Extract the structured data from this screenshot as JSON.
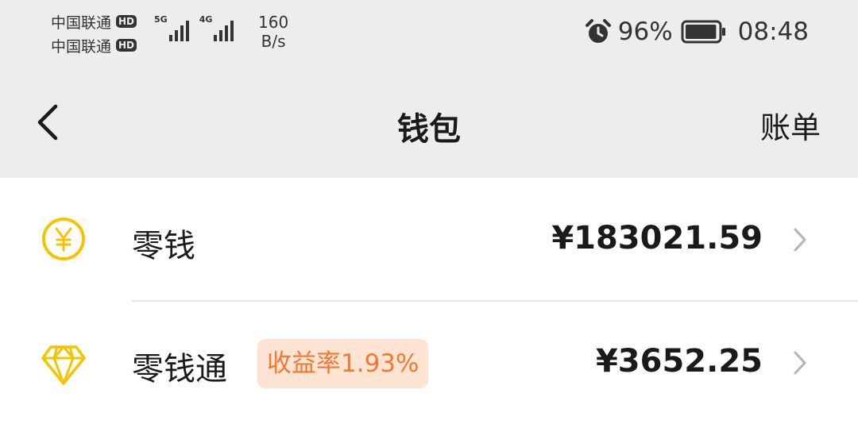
{
  "status_bar": {
    "carriers": [
      {
        "name": "中国联通",
        "badge": "HD"
      },
      {
        "name": "中国联通",
        "badge": "HD"
      }
    ],
    "signals": [
      {
        "network": "5G",
        "strength": 4
      },
      {
        "network": "4G",
        "strength": 4
      }
    ],
    "net_speed_value": "160",
    "net_speed_unit": "B/s",
    "alarm_icon": "alarm-clock-icon",
    "battery_percent": "96%",
    "battery_level": 0.96,
    "time": "08:48"
  },
  "nav": {
    "back_icon": "chevron-left-icon",
    "title": "钱包",
    "action": "账单"
  },
  "items": [
    {
      "icon": "yuan-coin-icon",
      "label": "零钱",
      "amount": "¥183021.59"
    },
    {
      "icon": "diamond-icon",
      "label": "零钱通",
      "badge": "收益率1.93%",
      "amount": "¥3652.25"
    }
  ],
  "colors": {
    "accent_yellow": "#f5c400",
    "badge_bg": "#fde4d2",
    "badge_text": "#f07a35",
    "header_bg": "#ededed"
  }
}
